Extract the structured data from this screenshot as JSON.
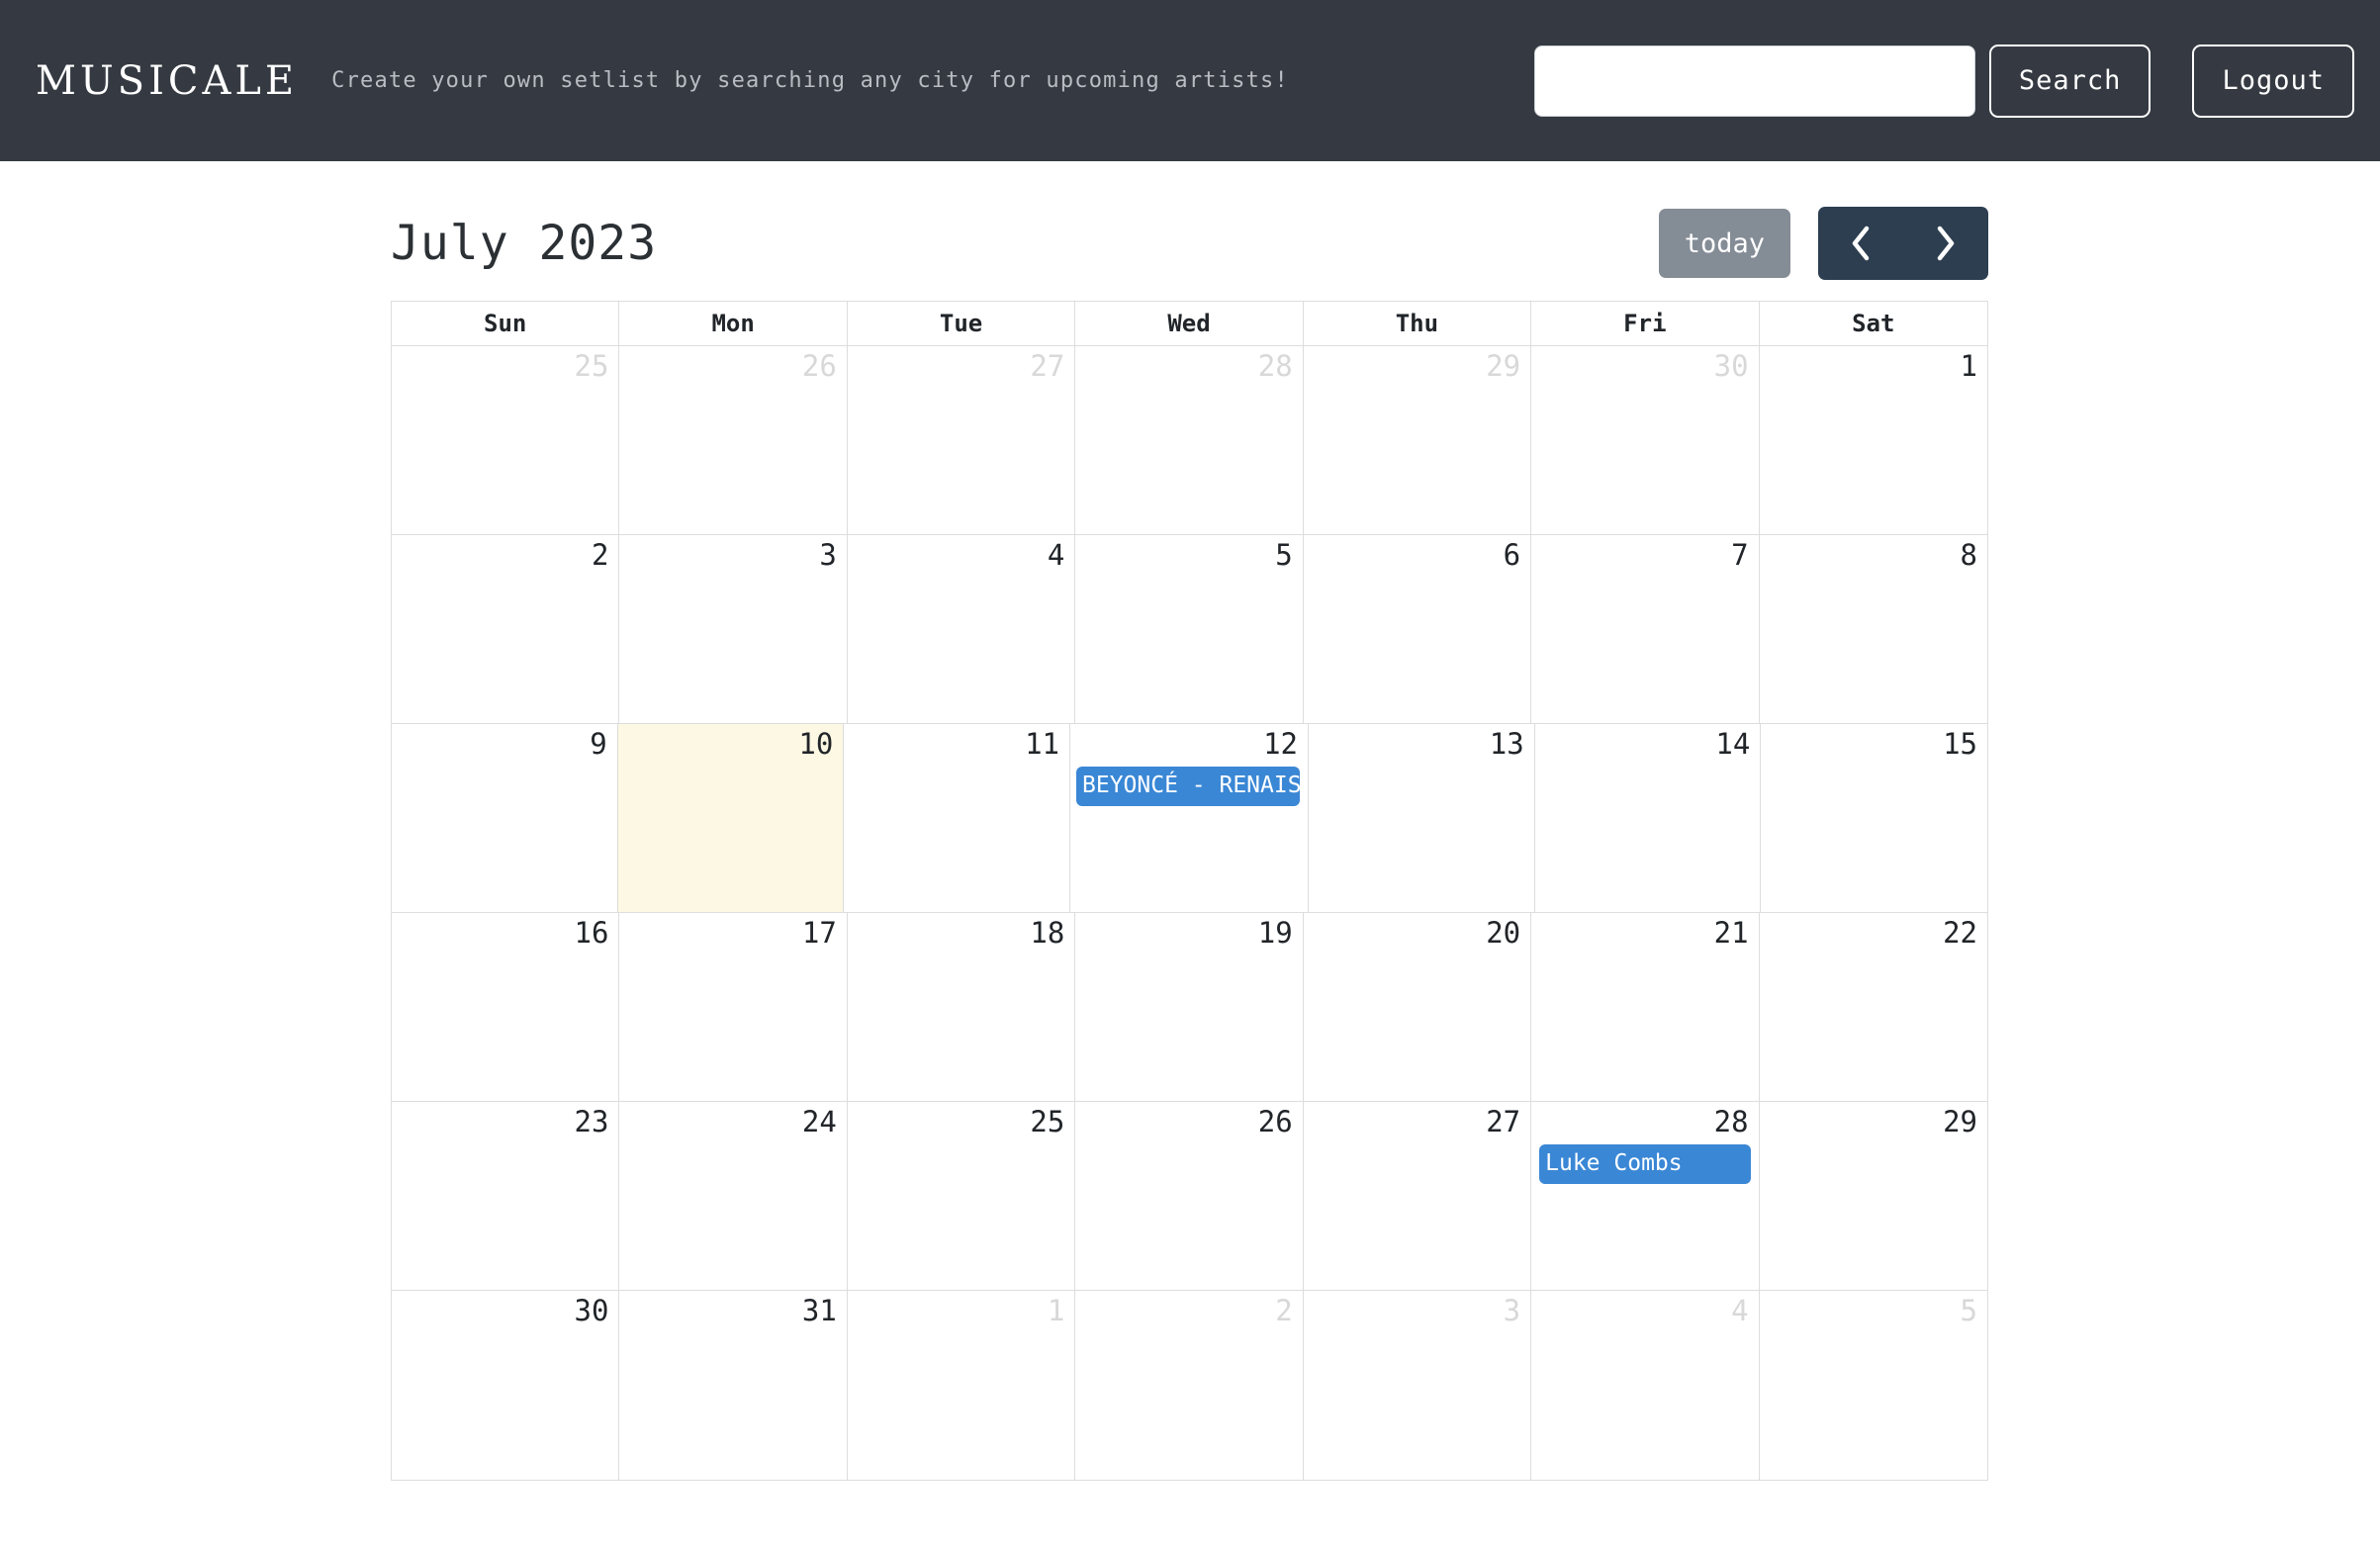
{
  "header": {
    "brand": "MUSICALE",
    "tagline": "Create your own setlist by searching any city for upcoming artists!",
    "search": {
      "value": "",
      "placeholder": ""
    },
    "search_button": "Search",
    "logout_button": "Logout"
  },
  "calendar": {
    "title": "July 2023",
    "today_button": "today",
    "prev_icon": "chevron-left-icon",
    "next_icon": "chevron-right-icon",
    "day_headers": [
      "Sun",
      "Mon",
      "Tue",
      "Wed",
      "Thu",
      "Fri",
      "Sat"
    ],
    "accent_event_color": "#3a87d5",
    "today_highlight_color": "#fcf8e3",
    "weeks": [
      [
        {
          "num": "25",
          "other": true
        },
        {
          "num": "26",
          "other": true
        },
        {
          "num": "27",
          "other": true
        },
        {
          "num": "28",
          "other": true
        },
        {
          "num": "29",
          "other": true
        },
        {
          "num": "30",
          "other": true
        },
        {
          "num": "1",
          "other": false
        }
      ],
      [
        {
          "num": "2",
          "other": false
        },
        {
          "num": "3",
          "other": false
        },
        {
          "num": "4",
          "other": false
        },
        {
          "num": "5",
          "other": false
        },
        {
          "num": "6",
          "other": false
        },
        {
          "num": "7",
          "other": false
        },
        {
          "num": "8",
          "other": false
        }
      ],
      [
        {
          "num": "9",
          "other": false
        },
        {
          "num": "10",
          "other": false,
          "today": true
        },
        {
          "num": "11",
          "other": false
        },
        {
          "num": "12",
          "other": false,
          "event": "BEYONCÉ - RENAISSANCE WORLD TOUR"
        },
        {
          "num": "13",
          "other": false
        },
        {
          "num": "14",
          "other": false
        },
        {
          "num": "15",
          "other": false
        }
      ],
      [
        {
          "num": "16",
          "other": false
        },
        {
          "num": "17",
          "other": false
        },
        {
          "num": "18",
          "other": false
        },
        {
          "num": "19",
          "other": false
        },
        {
          "num": "20",
          "other": false
        },
        {
          "num": "21",
          "other": false
        },
        {
          "num": "22",
          "other": false
        }
      ],
      [
        {
          "num": "23",
          "other": false
        },
        {
          "num": "24",
          "other": false
        },
        {
          "num": "25",
          "other": false
        },
        {
          "num": "26",
          "other": false
        },
        {
          "num": "27",
          "other": false
        },
        {
          "num": "28",
          "other": false,
          "event": "Luke Combs"
        },
        {
          "num": "29",
          "other": false
        }
      ],
      [
        {
          "num": "30",
          "other": false
        },
        {
          "num": "31",
          "other": false
        },
        {
          "num": "1",
          "other": true
        },
        {
          "num": "2",
          "other": true
        },
        {
          "num": "3",
          "other": true
        },
        {
          "num": "4",
          "other": true
        },
        {
          "num": "5",
          "other": true
        }
      ]
    ]
  }
}
